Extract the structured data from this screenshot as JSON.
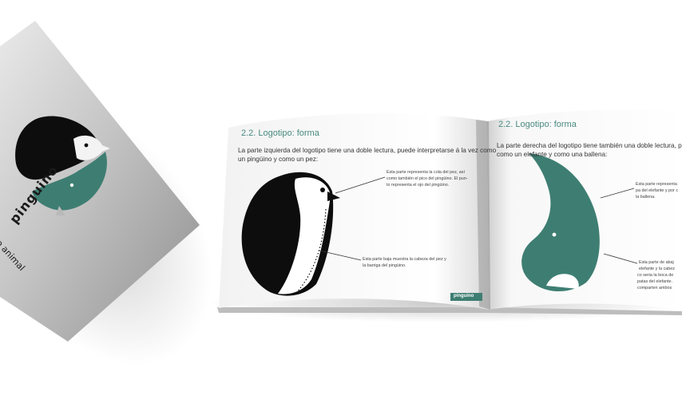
{
  "cover": {
    "wordmark": "pinguino",
    "tagline": "o animal"
  },
  "left_page": {
    "heading": "2.2. Logotipo: forma",
    "intro_line1": "La parte izquierda del logotipo tiene una doble lectura, puede interpretarse á la vez como",
    "intro_line2": "un pingüino y como un pez:",
    "note_top_l1": "Esta parte representa la cola del pez, así",
    "note_top_l2": "como también el pico del pingüino. El pun-",
    "note_top_l3": "to representa el ojo del pingüino.",
    "note_bottom_l1": "Esta parte baja muestra la cabeza del pez y",
    "note_bottom_l2": "la barriga del pingüino.",
    "footer_badge": "pinguino"
  },
  "right_page": {
    "heading": "2.2. Logotipo: forma",
    "intro_line1": "La parte derecha del logotipo tiene también una doble lectura, puede i",
    "intro_line2": "como un elefante y como una ballena:",
    "note_top_l1": "Esta parte representa",
    "note_top_l2": "pa del elefante y por c",
    "note_top_l3": "la ballena.",
    "note_bottom_l1": "Esta parte de abaj",
    "note_bottom_l2": "elefante y la cabez",
    "note_bottom_l3": "co seria la boca de",
    "note_bottom_l4": "patas del elefante.",
    "note_bottom_l5": "comparten ambos"
  },
  "colors": {
    "teal": "#3e7e72",
    "black": "#0d0d0d",
    "cover_gray": "#b9b9b9"
  }
}
